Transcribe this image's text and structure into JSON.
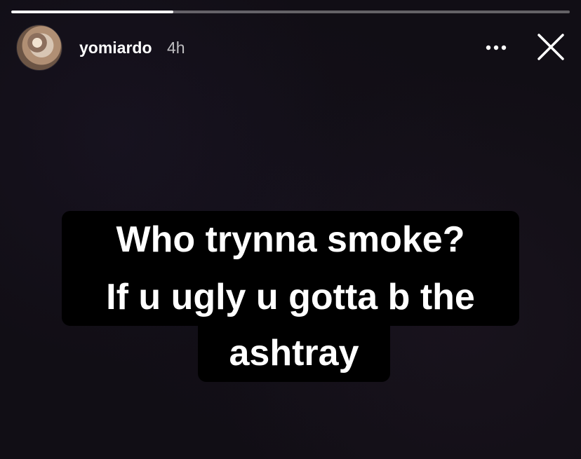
{
  "story": {
    "progress_fraction": 0.29
  },
  "header": {
    "username": "yomiardo",
    "time": "4h",
    "more_icon": "more-horizontal-icon",
    "close_icon": "close-icon"
  },
  "content": {
    "lines": [
      "Who trynna smoke?",
      "If u ugly u gotta b the",
      "ashtray"
    ]
  }
}
